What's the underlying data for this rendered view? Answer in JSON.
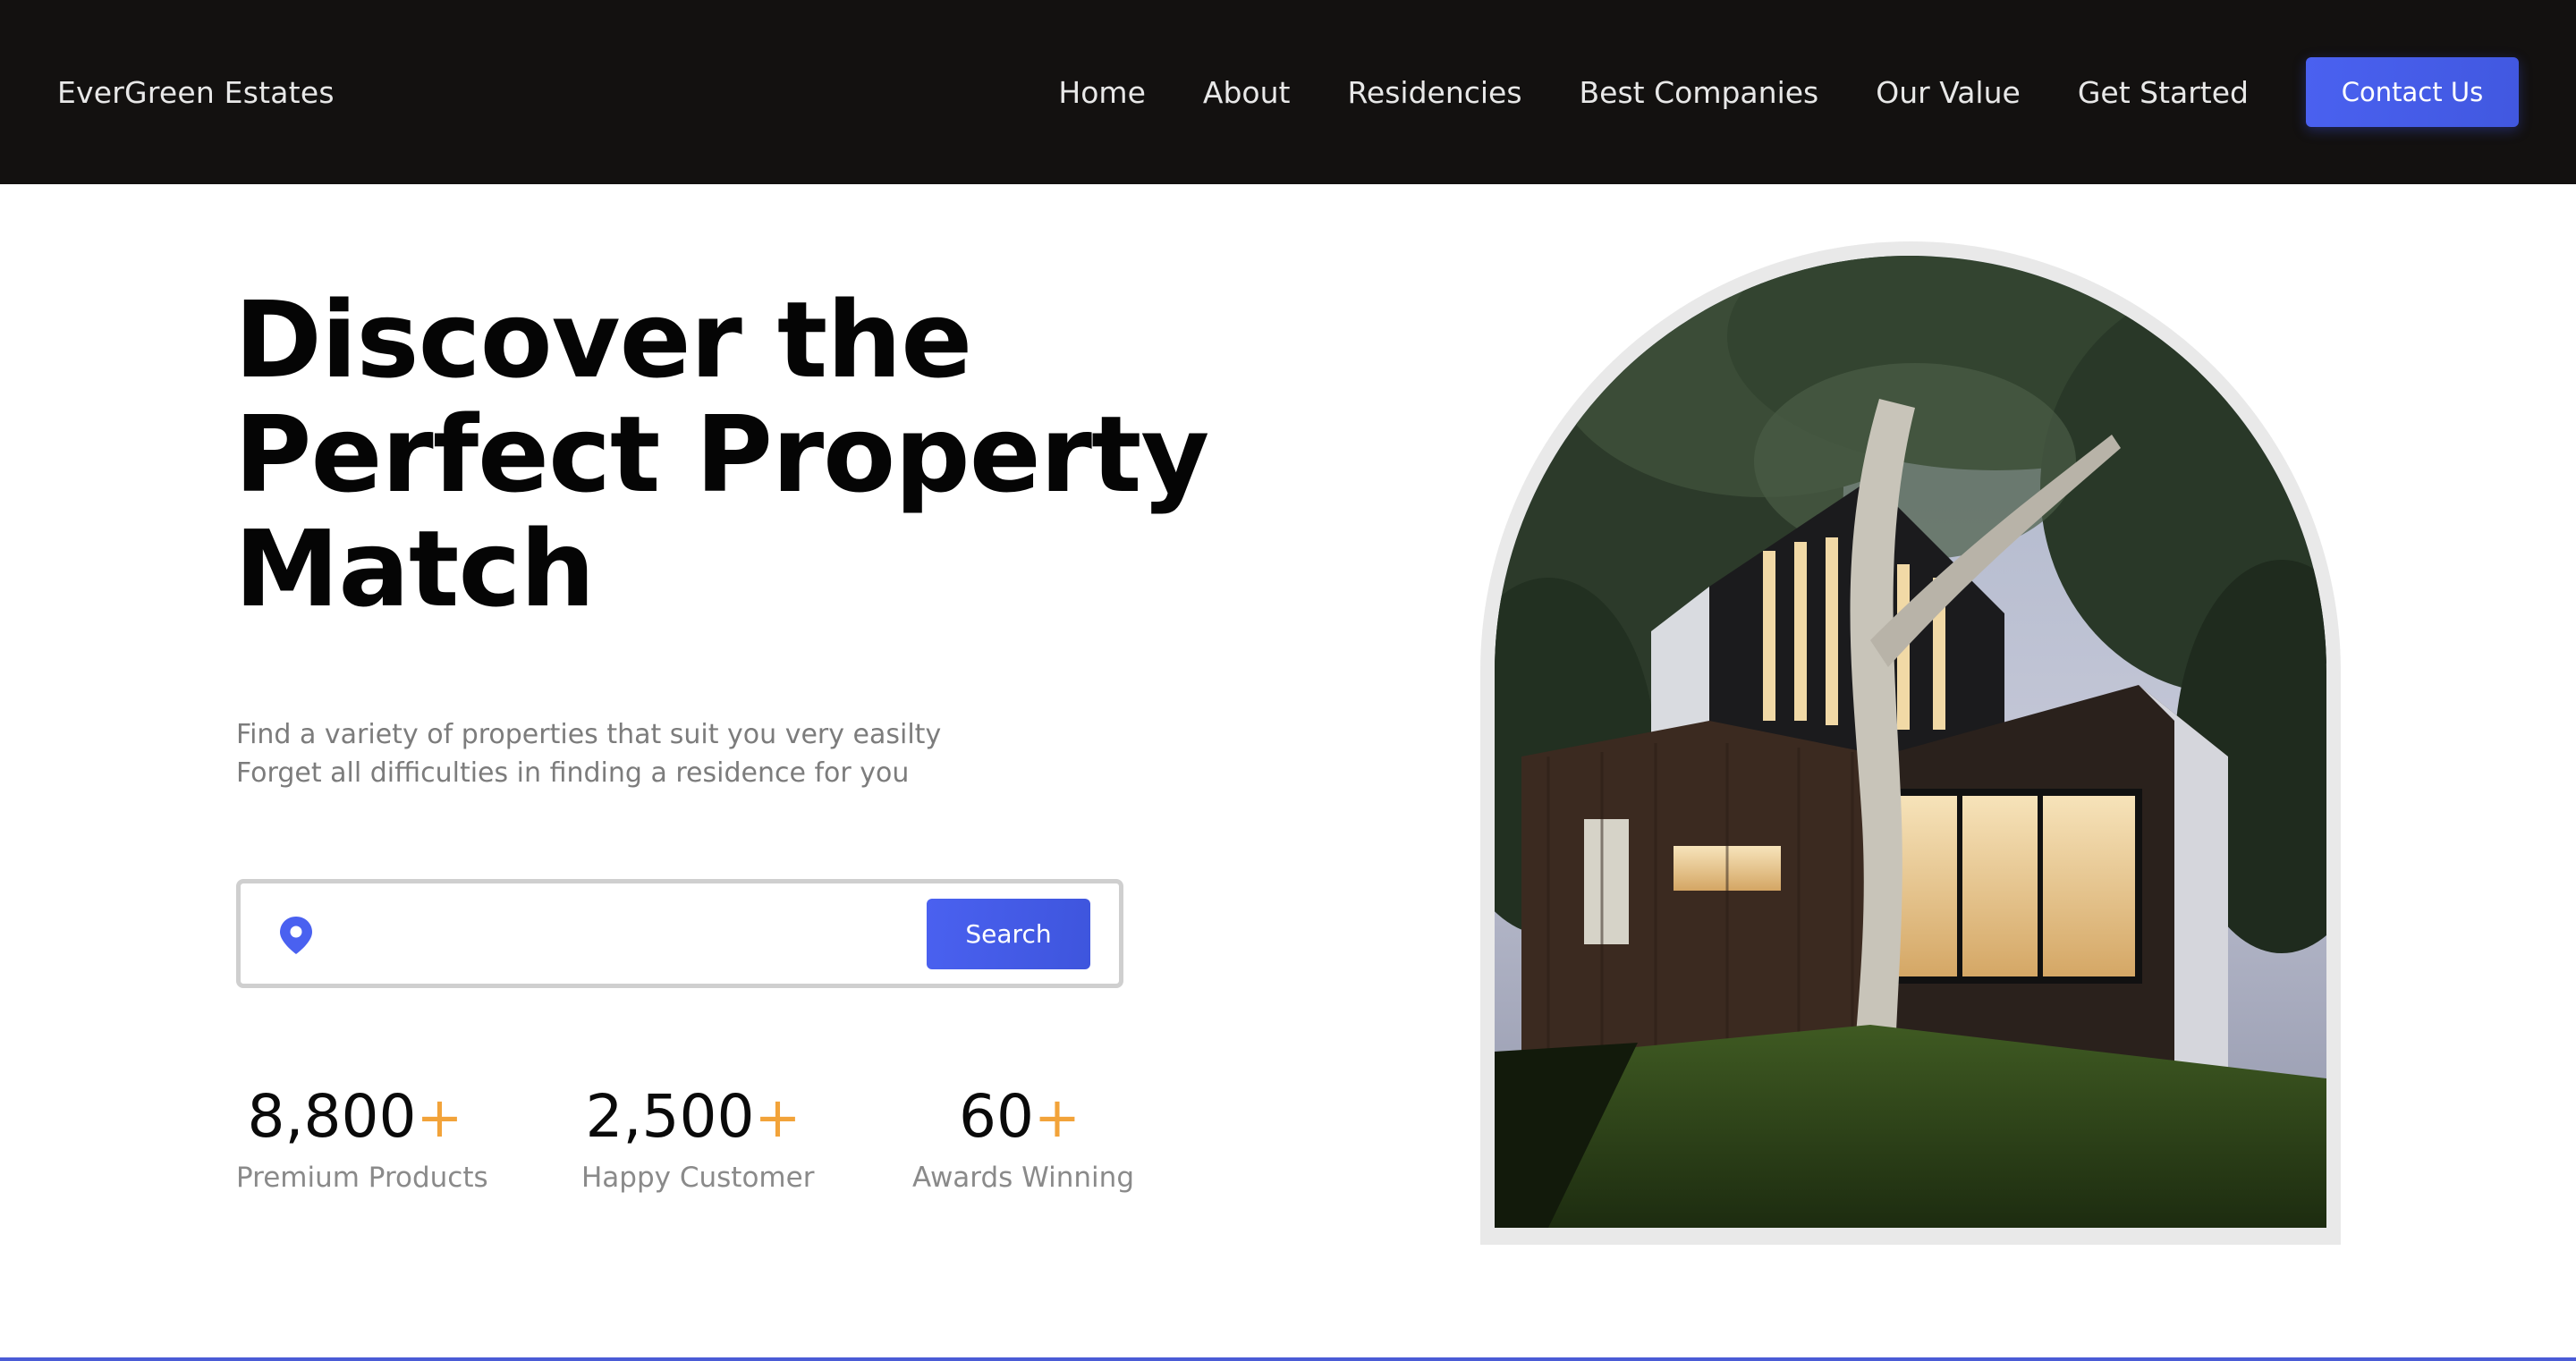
{
  "header": {
    "brand": "EverGreen Estates",
    "nav": [
      "Home",
      "About",
      "Residencies",
      "Best Companies",
      "Our Value",
      "Get Started"
    ],
    "contact_label": "Contact Us"
  },
  "hero": {
    "title_lines": [
      "Discover the",
      "Perfect Property",
      "Match"
    ],
    "subtitle_lines": [
      "Find a variety of properties that suit you very easilty",
      "Forget all difficulties in finding a residence for you"
    ],
    "search": {
      "placeholder": "",
      "button_label": "Search",
      "icon": "location-pin-icon"
    },
    "stats": [
      {
        "value": "8,800",
        "suffix": "+",
        "label": "Premium Products"
      },
      {
        "value": "2,500",
        "suffix": "+",
        "label": "Happy Customer"
      },
      {
        "value": "60",
        "suffix": "+",
        "label": "Awards Winning"
      }
    ]
  },
  "colors": {
    "nav_background": "#131110",
    "accent_blue": "#4a61f0",
    "plus_orange": "#f2a33a",
    "arch_frame": "#e9e9e9"
  }
}
